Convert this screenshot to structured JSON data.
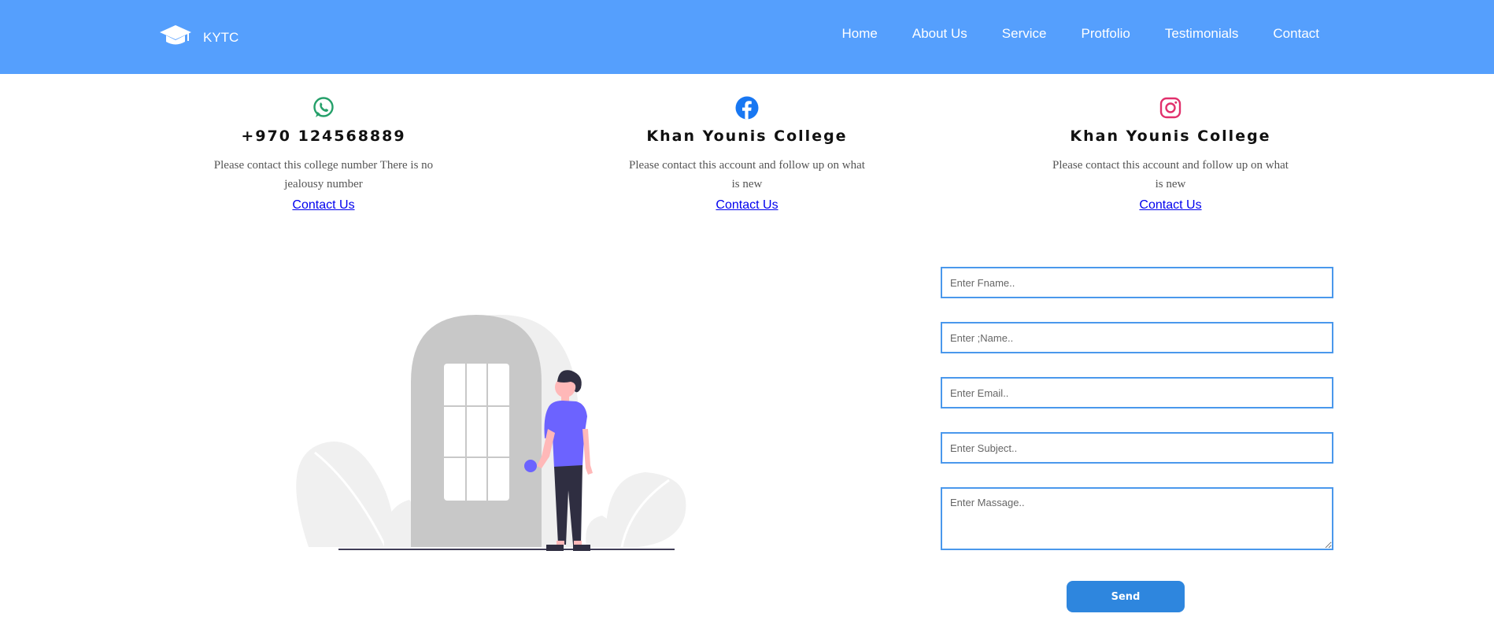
{
  "brand": {
    "name": "KYTC",
    "icon": "graduation-cap-icon"
  },
  "nav": {
    "items": [
      "Home",
      "About Us",
      "Service",
      "Protfolio",
      "Testimonials",
      "Contact"
    ]
  },
  "contact_cards": [
    {
      "icon": "whatsapp-icon",
      "title": "+970 124568889",
      "text": "Please contact this college number There is no jealousy number",
      "link": "Contact Us"
    },
    {
      "icon": "facebook-icon",
      "title": "Khan Younis College",
      "text": "Please contact this account and follow up on what is new",
      "link": "Contact Us"
    },
    {
      "icon": "instagram-icon",
      "title": "Khan Younis College",
      "text": "Please contact this account and follow up on what is new",
      "link": "Contact Us"
    }
  ],
  "form": {
    "fname_placeholder": "Enter Fname..",
    "lname_placeholder": "Enter ;Name..",
    "email_placeholder": "Enter Email..",
    "subject_placeholder": "Enter Subject..",
    "message_placeholder": "Enter Massage..",
    "send_label": "Send"
  },
  "colors": {
    "navbar": "#559ffd",
    "whatsapp": "#25a06a",
    "facebook": "#1877f2",
    "instagram": "#e1306c",
    "send_button": "#2e86de",
    "field_border": "#4a98ec"
  }
}
